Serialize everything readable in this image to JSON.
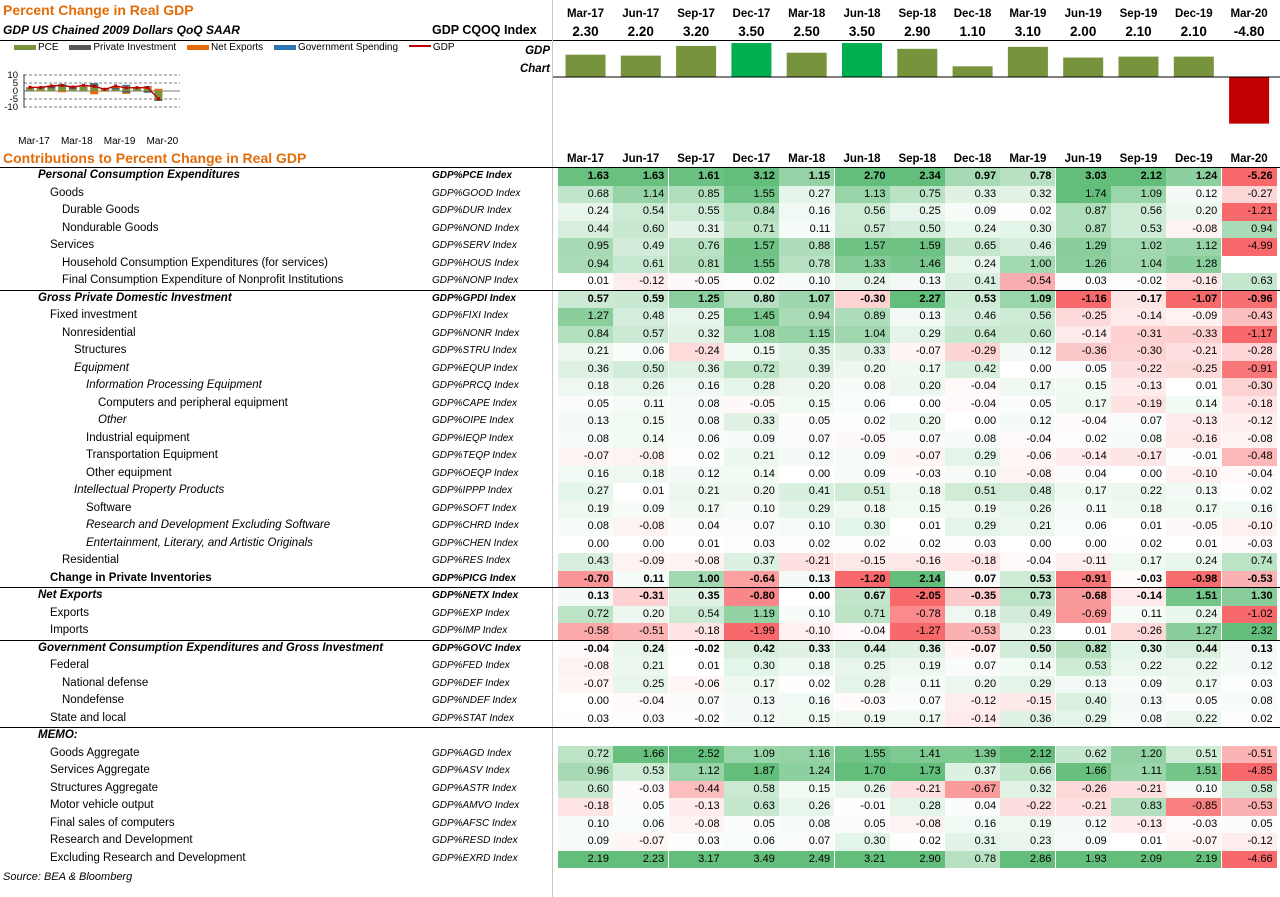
{
  "chart_data": {
    "type": "bar",
    "title": "Percent Change in Real GDP",
    "subtitle": "GDP US Chained 2009 Dollars QoQ SAAR",
    "series_name": "GDP CQOQ Index",
    "row_label": "GDP Chart",
    "categories": [
      "Mar-17",
      "Jun-17",
      "Sep-17",
      "Dec-17",
      "Mar-18",
      "Jun-18",
      "Sep-18",
      "Dec-18",
      "Mar-19",
      "Jun-19",
      "Sep-19",
      "Dec-19",
      "Mar-20"
    ],
    "values": [
      2.3,
      2.2,
      3.2,
      3.5,
      2.5,
      3.5,
      2.9,
      1.1,
      3.1,
      2.0,
      2.1,
      2.1,
      -4.8
    ],
    "labels": [
      "2.30",
      "2.20",
      "3.20",
      "3.50",
      "2.50",
      "3.50",
      "2.90",
      "1.10",
      "3.10",
      "2.00",
      "2.10",
      "2.10",
      "-4.80"
    ],
    "colors": {
      "normal": "#77933c",
      "high": "#00b050",
      "negative": "#c00000"
    },
    "mini_chart": {
      "type": "bar",
      "legend": [
        "PCE",
        "Private Investment",
        "Net Exports",
        "Government Spending",
        "GDP"
      ],
      "legend_colors": [
        "#77933c",
        "#595959",
        "#e46c0a",
        "#2e75b6",
        "#c00000"
      ],
      "yticks": [
        "10",
        "5",
        "0",
        "-5",
        "-10"
      ],
      "ylim": [
        -10,
        10
      ],
      "xticks": [
        "Mar-17",
        "Mar-18",
        "Mar-19",
        "Mar-20"
      ],
      "pce": [
        1.63,
        1.63,
        1.61,
        3.12,
        1.15,
        2.7,
        2.34,
        0.97,
        0.78,
        3.03,
        2.12,
        1.24,
        -5.26
      ],
      "private_investment": [
        0.57,
        0.59,
        1.25,
        0.8,
        1.07,
        -0.3,
        2.27,
        0.53,
        1.09,
        -1.16,
        -0.17,
        -1.07,
        -0.96
      ],
      "net_exports": [
        0.13,
        -0.31,
        0.35,
        -0.8,
        0.0,
        0.67,
        -2.05,
        -0.35,
        0.73,
        -0.68,
        -0.14,
        1.51,
        1.3
      ],
      "government_spending": [
        -0.04,
        0.24,
        -0.02,
        0.42,
        0.33,
        0.44,
        0.36,
        -0.07,
        0.5,
        0.82,
        0.3,
        0.44,
        0.13
      ],
      "gdp": [
        2.3,
        2.2,
        3.2,
        3.5,
        2.5,
        3.5,
        2.9,
        1.1,
        3.1,
        2.0,
        2.1,
        2.1,
        -4.8
      ]
    }
  },
  "contributions": {
    "title": "Contributions to Percent Change in Real GDP",
    "columns": [
      "Mar-17",
      "Jun-17",
      "Sep-17",
      "Dec-17",
      "Mar-18",
      "Jun-18",
      "Sep-18",
      "Dec-18",
      "Mar-19",
      "Jun-19",
      "Sep-19",
      "Dec-19",
      "Mar-20"
    ],
    "rows": [
      {
        "label": "Personal Consumption Expenditures",
        "ticker": "GDP%PCE Index",
        "indent": 0,
        "bold": true,
        "section": true,
        "values": [
          "1.63",
          "1.63",
          "1.61",
          "3.12",
          "1.15",
          "2.70",
          "2.34",
          "0.97",
          "0.78",
          "3.03",
          "2.12",
          "1.24",
          "-5.26"
        ]
      },
      {
        "label": "Goods",
        "ticker": "GDP%GOOD Index",
        "indent": 1,
        "values": [
          "0.68",
          "1.14",
          "0.85",
          "1.55",
          "0.27",
          "1.13",
          "0.75",
          "0.33",
          "0.32",
          "1.74",
          "1.09",
          "0.12",
          "-0.27"
        ]
      },
      {
        "label": "Durable Goods",
        "ticker": "GDP%DUR Index",
        "indent": 2,
        "values": [
          "0.24",
          "0.54",
          "0.55",
          "0.84",
          "0.16",
          "0.56",
          "0.25",
          "0.09",
          "0.02",
          "0.87",
          "0.56",
          "0.20",
          "-1.21"
        ]
      },
      {
        "label": "Nondurable Goods",
        "ticker": "GDP%NOND Index",
        "indent": 2,
        "values": [
          "0.44",
          "0.60",
          "0.31",
          "0.71",
          "0.11",
          "0.57",
          "0.50",
          "0.24",
          "0.30",
          "0.87",
          "0.53",
          "-0.08",
          "0.94"
        ]
      },
      {
        "label": "Services",
        "ticker": "GDP%SERV Index",
        "indent": 1,
        "values": [
          "0.95",
          "0.49",
          "0.76",
          "1.57",
          "0.88",
          "1.57",
          "1.59",
          "0.65",
          "0.46",
          "1.29",
          "1.02",
          "1.12",
          "-4.99"
        ]
      },
      {
        "label": "Household Consumption Expenditures (for services)",
        "ticker": "GDP%HOUS Index",
        "indent": 2,
        "values": [
          "0.94",
          "0.61",
          "0.81",
          "1.55",
          "0.78",
          "1.33",
          "1.46",
          "0.24",
          "1.00",
          "1.26",
          "1.04",
          "1.28",
          ""
        ]
      },
      {
        "label": "Final Consumption Expenditure of Nonprofit Institutions",
        "ticker": "GDP%NONP Index",
        "indent": 2,
        "values": [
          "0.01",
          "-0.12",
          "-0.05",
          "0.02",
          "0.10",
          "0.24",
          "0.13",
          "0.41",
          "-0.54",
          "0.03",
          "-0.02",
          "-0.16",
          "0.63"
        ]
      },
      {
        "label": "Gross Private Domestic Investment",
        "ticker": "GDP%GPDI Index",
        "indent": 0,
        "bold": true,
        "section": true,
        "values": [
          "0.57",
          "0.59",
          "1.25",
          "0.80",
          "1.07",
          "-0.30",
          "2.27",
          "0.53",
          "1.09",
          "-1.16",
          "-0.17",
          "-1.07",
          "-0.96"
        ]
      },
      {
        "label": "Fixed investment",
        "ticker": "GDP%FIXI Index",
        "indent": 1,
        "values": [
          "1.27",
          "0.48",
          "0.25",
          "1.45",
          "0.94",
          "0.89",
          "0.13",
          "0.46",
          "0.56",
          "-0.25",
          "-0.14",
          "-0.09",
          "-0.43"
        ]
      },
      {
        "label": "Nonresidential",
        "ticker": "GDP%NONR Index",
        "indent": 2,
        "values": [
          "0.84",
          "0.57",
          "0.32",
          "1.08",
          "1.15",
          "1.04",
          "0.29",
          "0.64",
          "0.60",
          "-0.14",
          "-0.31",
          "-0.33",
          "-1.17"
        ]
      },
      {
        "label": "Structures",
        "ticker": "GDP%STRU Index",
        "indent": 3,
        "values": [
          "0.21",
          "0.06",
          "-0.24",
          "0.15",
          "0.35",
          "0.33",
          "-0.07",
          "-0.29",
          "0.12",
          "-0.36",
          "-0.30",
          "-0.21",
          "-0.28"
        ]
      },
      {
        "label": "Equipment",
        "ticker": "GDP%EQUP Index",
        "indent": 3,
        "italic": true,
        "values": [
          "0.36",
          "0.50",
          "0.36",
          "0.72",
          "0.39",
          "0.20",
          "0.17",
          "0.42",
          "0.00",
          "0.05",
          "-0.22",
          "-0.25",
          "-0.91"
        ]
      },
      {
        "label": "Information Processing Equipment",
        "ticker": "GDP%PRCQ Index",
        "indent": 4,
        "italic": true,
        "values": [
          "0.18",
          "0.26",
          "0.16",
          "0.28",
          "0.20",
          "0.08",
          "0.20",
          "-0.04",
          "0.17",
          "0.15",
          "-0.13",
          "0.01",
          "-0.30"
        ]
      },
      {
        "label": "Computers and peripheral equipment",
        "ticker": "GDP%CAPE Index",
        "indent": 5,
        "values": [
          "0.05",
          "0.11",
          "0.08",
          "-0.05",
          "0.15",
          "0.06",
          "0.00",
          "-0.04",
          "0.05",
          "0.17",
          "-0.19",
          "0.14",
          "-0.18"
        ]
      },
      {
        "label": "Other",
        "ticker": "GDP%OIPE Index",
        "indent": 5,
        "italic": true,
        "values": [
          "0.13",
          "0.15",
          "0.08",
          "0.33",
          "0.05",
          "0.02",
          "0.20",
          "0.00",
          "0.12",
          "-0.04",
          "0.07",
          "-0.13",
          "-0.12"
        ]
      },
      {
        "label": "Industrial equipment",
        "ticker": "GDP%IEQP Index",
        "indent": 4,
        "values": [
          "0.08",
          "0.14",
          "0.06",
          "0.09",
          "0.07",
          "-0.05",
          "0.07",
          "0.08",
          "-0.04",
          "0.02",
          "0.08",
          "-0.16",
          "-0.08"
        ]
      },
      {
        "label": "Transportation Equipment",
        "ticker": "GDP%TEQP Index",
        "indent": 4,
        "values": [
          "-0.07",
          "-0.08",
          "0.02",
          "0.21",
          "0.12",
          "0.09",
          "-0.07",
          "0.29",
          "-0.06",
          "-0.14",
          "-0.17",
          "-0.01",
          "-0.48"
        ]
      },
      {
        "label": "Other equipment",
        "ticker": "GDP%OEQP Index",
        "indent": 4,
        "values": [
          "0.16",
          "0.18",
          "0.12",
          "0.14",
          "0.00",
          "0.09",
          "-0.03",
          "0.10",
          "-0.08",
          "0.04",
          "0.00",
          "-0.10",
          "-0.04"
        ]
      },
      {
        "label": "Intellectual Property Products",
        "ticker": "GDP%IPPP Index",
        "indent": 3,
        "italic": true,
        "values": [
          "0.27",
          "0.01",
          "0.21",
          "0.20",
          "0.41",
          "0.51",
          "0.18",
          "0.51",
          "0.48",
          "0.17",
          "0.22",
          "0.13",
          "0.02"
        ]
      },
      {
        "label": "Software",
        "ticker": "GDP%SOFT Index",
        "indent": 4,
        "values": [
          "0.19",
          "0.09",
          "0.17",
          "0.10",
          "0.29",
          "0.18",
          "0.15",
          "0.19",
          "0.26",
          "0.11",
          "0.18",
          "0.17",
          "0.16"
        ]
      },
      {
        "label": "Research and Development Excluding Software",
        "ticker": "GDP%CHRD Index",
        "indent": 4,
        "italic": true,
        "values": [
          "0.08",
          "-0.08",
          "0.04",
          "0.07",
          "0.10",
          "0.30",
          "0.01",
          "0.29",
          "0.21",
          "0.06",
          "0.01",
          "-0.05",
          "-0.10"
        ]
      },
      {
        "label": "Entertainment, Literary, and Artistic Originals",
        "ticker": "GDP%CHEN Index",
        "indent": 4,
        "italic": true,
        "values": [
          "0.00",
          "0.00",
          "0.01",
          "0.03",
          "0.02",
          "0.02",
          "0.02",
          "0.03",
          "0.00",
          "0.00",
          "0.02",
          "0.01",
          "-0.03"
        ]
      },
      {
        "label": "Residential",
        "ticker": "GDP%RES Index",
        "indent": 2,
        "values": [
          "0.43",
          "-0.09",
          "-0.08",
          "0.37",
          "-0.21",
          "-0.15",
          "-0.16",
          "-0.18",
          "-0.04",
          "-0.11",
          "0.17",
          "0.24",
          "0.74"
        ]
      },
      {
        "label": "Change in Private Inventories",
        "ticker": "GDP%PICG Index",
        "indent": 1,
        "bold": true,
        "noital": true,
        "values": [
          "-0.70",
          "0.11",
          "1.00",
          "-0.64",
          "0.13",
          "-1.20",
          "2.14",
          "0.07",
          "0.53",
          "-0.91",
          "-0.03",
          "-0.98",
          "-0.53"
        ]
      },
      {
        "label": "Net Exports",
        "ticker": "GDP%NETX Index",
        "indent": 0,
        "bold": true,
        "section": true,
        "values": [
          "0.13",
          "-0.31",
          "0.35",
          "-0.80",
          "0.00",
          "0.67",
          "-2.05",
          "-0.35",
          "0.73",
          "-0.68",
          "-0.14",
          "1.51",
          "1.30"
        ]
      },
      {
        "label": "Exports",
        "ticker": "GDP%EXP Index",
        "indent": 1,
        "values": [
          "0.72",
          "0.20",
          "0.54",
          "1.19",
          "0.10",
          "0.71",
          "-0.78",
          "0.18",
          "0.49",
          "-0.69",
          "0.11",
          "0.24",
          "-1.02"
        ]
      },
      {
        "label": "Imports",
        "ticker": "GDP%IMP Index",
        "indent": 1,
        "values": [
          "-0.58",
          "-0.51",
          "-0.18",
          "-1.99",
          "-0.10",
          "-0.04",
          "-1.27",
          "-0.53",
          "0.23",
          "0.01",
          "-0.26",
          "1.27",
          "2.32"
        ]
      },
      {
        "label": "Government Consumption Expenditures and Gross Investment",
        "ticker": "GDP%GOVC Index",
        "indent": 0,
        "bold": true,
        "section": true,
        "values": [
          "-0.04",
          "0.24",
          "-0.02",
          "0.42",
          "0.33",
          "0.44",
          "0.36",
          "-0.07",
          "0.50",
          "0.82",
          "0.30",
          "0.44",
          "0.13"
        ]
      },
      {
        "label": "Federal",
        "ticker": "GDP%FED Index",
        "indent": 1,
        "values": [
          "-0.08",
          "0.21",
          "0.01",
          "0.30",
          "0.18",
          "0.25",
          "0.19",
          "0.07",
          "0.14",
          "0.53",
          "0.22",
          "0.22",
          "0.12"
        ]
      },
      {
        "label": "National defense",
        "ticker": "GDP%DEF Index",
        "indent": 2,
        "values": [
          "-0.07",
          "0.25",
          "-0.06",
          "0.17",
          "0.02",
          "0.28",
          "0.11",
          "0.20",
          "0.29",
          "0.13",
          "0.09",
          "0.17",
          "0.03"
        ]
      },
      {
        "label": "Nondefense",
        "ticker": "GDP%NDEF Index",
        "indent": 2,
        "values": [
          "0.00",
          "-0.04",
          "0.07",
          "0.13",
          "0.16",
          "-0.03",
          "0.07",
          "-0.12",
          "-0.15",
          "0.40",
          "0.13",
          "0.05",
          "0.08"
        ]
      },
      {
        "label": "State and local",
        "ticker": "GDP%STAT Index",
        "indent": 1,
        "values": [
          "0.03",
          "0.03",
          "-0.02",
          "0.12",
          "0.15",
          "0.19",
          "0.17",
          "-0.14",
          "0.36",
          "0.29",
          "0.08",
          "0.22",
          "0.02"
        ]
      },
      {
        "label": "MEMO:",
        "ticker": "",
        "indent": 0,
        "bold": true,
        "section": true,
        "memo": true,
        "values": [
          "",
          "",
          "",
          "",
          "",
          "",
          "",
          "",
          "",
          "",
          "",
          "",
          ""
        ]
      },
      {
        "label": "Goods Aggregate",
        "ticker": "GDP%AGD Index",
        "indent": 1,
        "values": [
          "0.72",
          "1.66",
          "2.52",
          "1.09",
          "1.16",
          "1.55",
          "1.41",
          "1.39",
          "2.12",
          "0.62",
          "1.20",
          "0.51",
          "-0.51"
        ]
      },
      {
        "label": "Services Aggregate",
        "ticker": "GDP%ASV Index",
        "indent": 1,
        "values": [
          "0.96",
          "0.53",
          "1.12",
          "1.87",
          "1.24",
          "1.70",
          "1.73",
          "0.37",
          "0.66",
          "1.66",
          "1.11",
          "1.51",
          "-4.85"
        ]
      },
      {
        "label": "Structures Aggregate",
        "ticker": "GDP%ASTR Index",
        "indent": 1,
        "values": [
          "0.60",
          "-0.03",
          "-0.44",
          "0.58",
          "0.15",
          "0.26",
          "-0.21",
          "-0.67",
          "0.32",
          "-0.26",
          "-0.21",
          "0.10",
          "0.58"
        ]
      },
      {
        "label": "Motor vehicle output",
        "ticker": "GDP%AMVO Index",
        "indent": 1,
        "values": [
          "-0.18",
          "0.05",
          "-0.13",
          "0.63",
          "0.26",
          "-0.01",
          "0.28",
          "0.04",
          "-0.22",
          "-0.21",
          "0.83",
          "-0.85",
          "-0.53"
        ]
      },
      {
        "label": "Final sales of computers",
        "ticker": "GDP%AFSC Index",
        "indent": 1,
        "values": [
          "0.10",
          "0.06",
          "-0.08",
          "0.05",
          "0.08",
          "0.05",
          "-0.08",
          "0.16",
          "0.19",
          "0.12",
          "-0.13",
          "-0.03",
          "0.05"
        ]
      },
      {
        "label": "Research and Development",
        "ticker": "GDP%RESD Index",
        "indent": 1,
        "values": [
          "0.09",
          "-0.07",
          "0.03",
          "0.06",
          "0.07",
          "0.30",
          "0.02",
          "0.31",
          "0.23",
          "0.09",
          "0.01",
          "-0.07",
          "-0.12"
        ]
      },
      {
        "label": "Excluding Research and Development",
        "ticker": "GDP%EXRD Index",
        "indent": 1,
        "values": [
          "2.19",
          "2.23",
          "3.17",
          "3.49",
          "2.49",
          "3.21",
          "2.90",
          "0.78",
          "2.86",
          "1.93",
          "2.09",
          "2.19",
          "-4.66"
        ]
      }
    ]
  },
  "source": "Source: BEA & Bloomberg"
}
